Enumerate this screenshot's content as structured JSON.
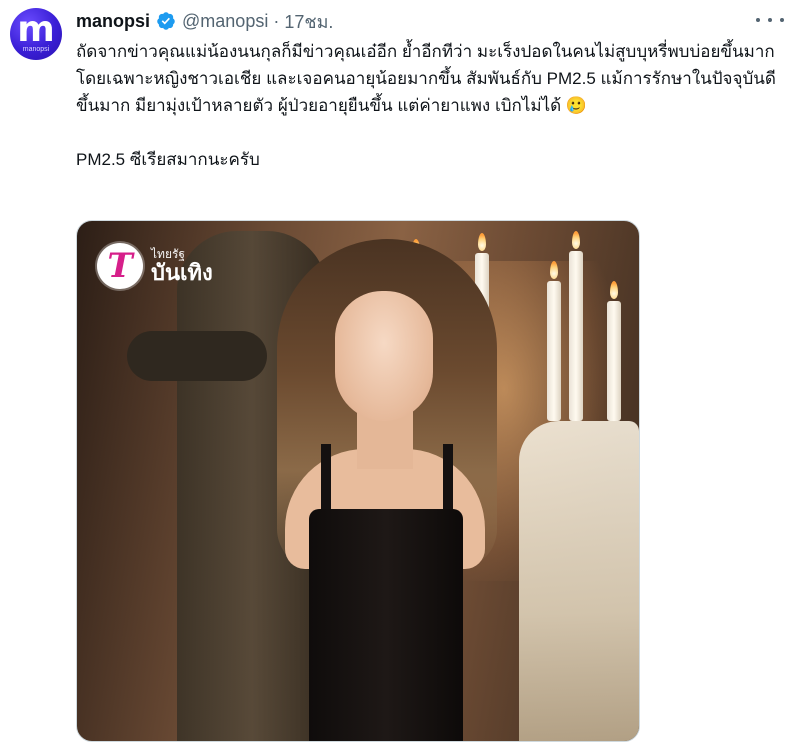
{
  "author": {
    "avatar_letter": "m",
    "avatar_sub": "manopsi",
    "name": "manopsi",
    "handle": "@manopsi",
    "separator": "·",
    "time": "17ชม.",
    "verified": true
  },
  "tweet": {
    "paragraph1": "ถัดจากข่าวคุณแม่น้องนนกุลก็มีข่าวคุณเอ๋อีก ย้ำอีกทีว่า มะเร็งปอดในคนไม่สูบบุหรี่พบบ่อยขึ้นมากโดยเฉพาะหญิงชาวเอเชีย และเจอคนอายุน้อยมากขึ้น สัมพันธ์กับ PM2.5 แม้การรักษาในปัจจุบันดีขึ้นมาก มียามุ่งเป้าหลายตัว ผู้ป่วยอายุยืนขึ้น แต่ค่ายาแพง เบิกไม่ได้ 🥲",
    "paragraph2": "PM2.5 ซีเรียสมากนะครับ"
  },
  "media": {
    "logo_letter": "T",
    "logo_small": "ไทยรัฐ",
    "logo_big": "บันเทิง"
  },
  "icons": {
    "verified": "verified-badge-icon",
    "more": "more-options-icon"
  },
  "colors": {
    "verified": "#1d9bf0",
    "secondary_text": "#536471",
    "avatar_bg": "#3a1fd6",
    "logo_accent": "#d61f8a"
  }
}
